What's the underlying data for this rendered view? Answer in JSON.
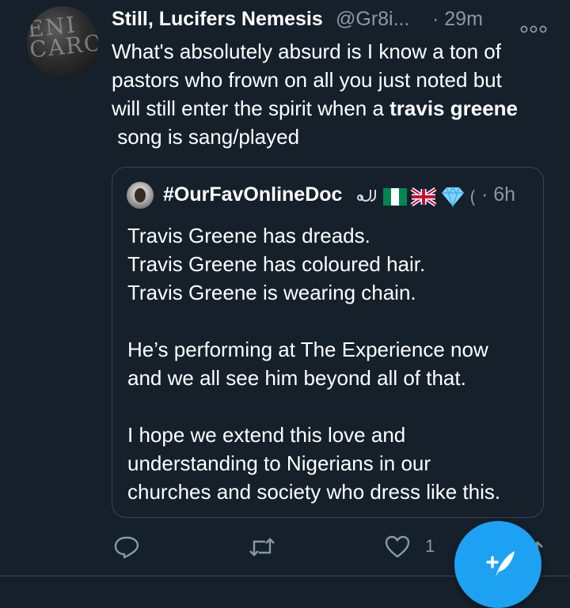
{
  "tweet": {
    "avatar_text": "ENI\nCARO",
    "display_name": "Still, Lucifers Nemesis",
    "handle": "@Gr8i...",
    "time": "· 29m",
    "text_lines": [
      "What's absolutely absurd is I know a ton of",
      "pastors who frown on all you just noted but",
      "will still enter the spirit when a "
    ],
    "text_bold": "travis greene",
    "text_end": " song is sang/played"
  },
  "quote": {
    "display_name": "#OurFavOnlineDoc",
    "time": "· 6h",
    "lines": [
      "Travis Greene has dreads.",
      "Travis Greene has coloured hair.",
      "Travis Greene is wearing chain.",
      "",
      "He’s performing at The Experience now",
      "and we all see him beyond all of that.",
      "",
      "I hope we extend this love and",
      "understanding to Nigerians in our",
      "churches and society who dress like this."
    ]
  },
  "actions": {
    "reply_icon": "reply-icon",
    "retweet_icon": "retweet-icon",
    "like_icon": "like-icon",
    "like_count": "1",
    "share_icon": "share-icon"
  },
  "fab": {
    "icon": "compose-tweet-icon"
  },
  "colors": {
    "background": "#15202b",
    "secondary_text": "#8899a6",
    "border": "#38444d",
    "accent": "#1da1f2"
  }
}
